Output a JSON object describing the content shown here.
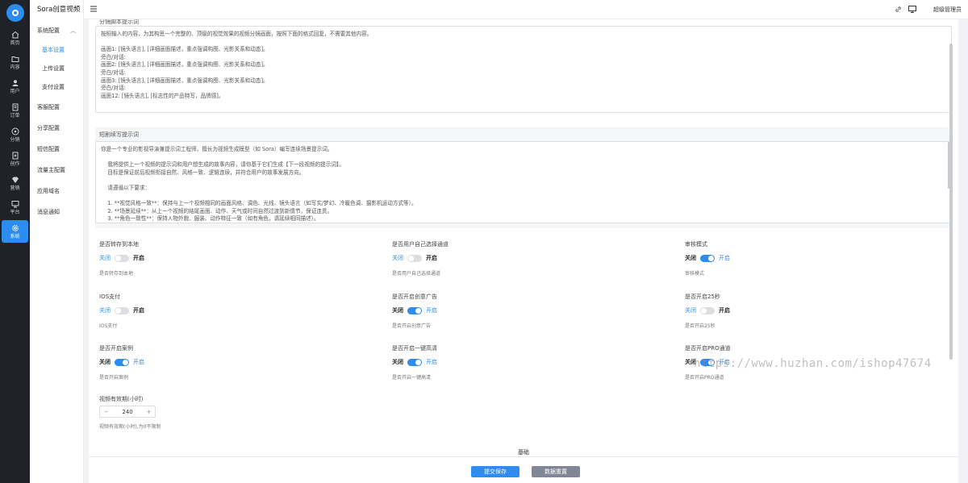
{
  "rail": {
    "items": [
      {
        "label": "首页",
        "icon": "home-icon"
      },
      {
        "label": "内容",
        "icon": "folder-icon"
      },
      {
        "label": "用户",
        "icon": "user-icon"
      },
      {
        "label": "订单",
        "icon": "order-icon"
      },
      {
        "label": "分销",
        "icon": "share-icon"
      },
      {
        "label": "创作",
        "icon": "create-icon"
      },
      {
        "label": "营销",
        "icon": "diamond-icon"
      },
      {
        "label": "平台",
        "icon": "monitor-icon"
      },
      {
        "label": "系统",
        "icon": "gear-icon",
        "active": true
      }
    ]
  },
  "sidebar": {
    "brand": "Sora创意视频",
    "group": "系统配置",
    "subitems": [
      "基本设置",
      "上传设置",
      "支付设置"
    ],
    "items": [
      "客服配置",
      "分享配置",
      "短信配置",
      "流量主配置",
      "应用域名",
      "消息通知"
    ]
  },
  "header": {
    "user": "超级管理员"
  },
  "form": {
    "prompt1": {
      "label": "分镜脚本提示词",
      "text": "按照输入的内容，为其构思一个完整的、顶级的视觉效果的视频分镜画面，按照下面的格式回复，不需要其他内容。\n\n画面1: [镜头语言], [详细画面描述，重点强调构图、光影关系和动态]。\n旁白/对话:\n画面2: [镜头语言], [详细画面描述，重点强调构图、光影关系和动态]。\n旁白/对话:\n画面3: [镜头语言], [详细画面描述，重点强调构图、光影关系和动态]。\n旁白/对话:\n画面12: [镜头语言], [标志性的产品特写，品牌感]。"
    },
    "prompt2": {
      "label": "短剧续写提示词",
      "text": "你是一个专业的影视导演兼提示词工程师，擅长为视频生成模型（如 Sora）编写连续场景提示词。\n\n    我将提供上一个视频的提示词和用户想生成的故事内容，请你基于它们生成【下一段视频的提示词】。\n    目标是保证前后视频衔接自然、风格一致、逻辑连续，并符合用户的故事发展方向。\n\n    请遵循以下要求：\n\n    1. **视觉风格一致**：保持与上一个视频相同的画面风格、调色、光线、镜头语言（如写实/梦幻、冷暖色调、摄影机运动方式等）。\n    2. **场景延续**：从上一个视频的结尾画面、动作、天气或时间自然过渡到新情节，保证连贯。\n    3. **角色一致性**：保持人物外貌、服装、动作特征一致（如有角色，请延续相同描述）。"
    },
    "switches": [
      {
        "label": "是否转存到本地",
        "off": "关闭",
        "on": "开启",
        "checked": false,
        "help": "是否转存到本地"
      },
      {
        "label": "是否用户自己选择通道",
        "off": "关闭",
        "on": "开启",
        "checked": false,
        "help": "是否用户自己选择通道"
      },
      {
        "label": "审核模式",
        "off": "关闭",
        "on": "开启",
        "checked": true,
        "help": "审核模式"
      },
      {
        "label": "IOS支付",
        "off": "关闭",
        "on": "开启",
        "checked": false,
        "help": "IOS支付"
      },
      {
        "label": "是否开启创意广告",
        "off": "关闭",
        "on": "开启",
        "checked": true,
        "help": "是否开启创意广告"
      },
      {
        "label": "是否开启25秒",
        "off": "关闭",
        "on": "开启",
        "checked": false,
        "help": "是否开启25秒"
      },
      {
        "label": "是否开启案例",
        "off": "关闭",
        "on": "开启",
        "checked": true,
        "help": "是否开启案例"
      },
      {
        "label": "是否开启一键高清",
        "off": "关闭",
        "on": "开启",
        "checked": true,
        "help": "是否开启一键高清"
      },
      {
        "label": "是否开启PRO通道",
        "off": "关闭",
        "on": "开启",
        "checked": true,
        "help": "是否开启PRO通道"
      }
    ],
    "validity": {
      "label": "视频有效期(小时)",
      "minus": "−",
      "value": "240",
      "plus": "+",
      "help": "视频有效期(小时),为0不限制"
    },
    "section_label": "基础",
    "submit": "提交保存",
    "reset": "数据重置"
  },
  "watermark": "https://www.huzhan.com/ishop47674",
  "colors": {
    "accent": "#2d8cf0",
    "rail_bg": "#1f2329",
    "reset_bg": "#808695"
  }
}
